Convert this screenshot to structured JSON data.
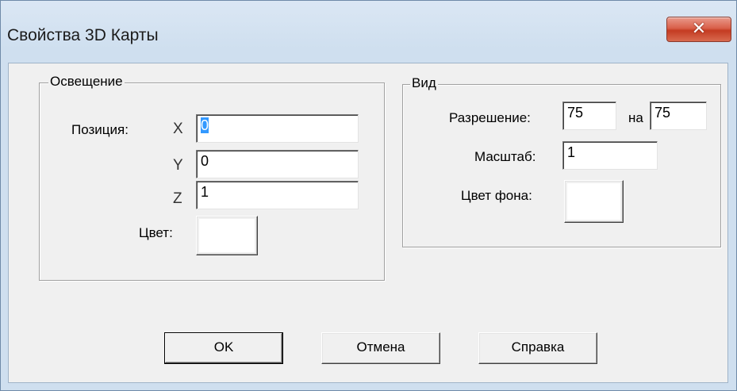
{
  "window": {
    "title": "Свойства 3D Карты",
    "close_glyph": "✕"
  },
  "lighting": {
    "group_label": "Освещение",
    "position_label": "Позиция:",
    "x_label": "X",
    "y_label": "Y",
    "z_label": "Z",
    "x_value": "0",
    "y_value": "0",
    "z_value": "1",
    "color_label": "Цвет:",
    "color_value": "#ffffff"
  },
  "view": {
    "group_label": "Вид",
    "resolution_label": "Разрешение:",
    "resolution_w": "75",
    "by_label": "на",
    "resolution_h": "75",
    "scale_label": "Масштаб:",
    "scale_value": "1",
    "bg_color_label": "Цвет фона:",
    "bg_color_value": "#ffffff"
  },
  "buttons": {
    "ok": "OK",
    "cancel": "Отмена",
    "help": "Справка"
  }
}
